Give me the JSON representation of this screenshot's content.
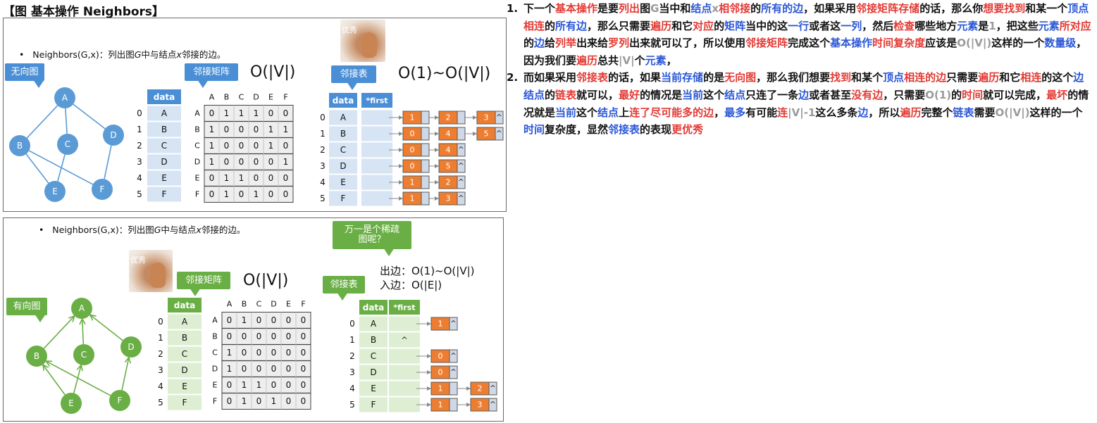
{
  "page_title": "【图 基本操作 Neighbors】",
  "colors": {
    "undirected_node": "#5b9bd5",
    "directed_node": "#6aaf45",
    "list_node": "#ed7d31",
    "table_head_blue": "#4a8fd6",
    "table_head_green": "#6aaf45",
    "highlight_red": "#e23a35",
    "highlight_blue": "#2a57d6"
  },
  "top": {
    "bullet": {
      "prefix": "Neighbors(G,x)：列出图",
      "var1": "G",
      "middle": "中与结点",
      "var2": "x",
      "suffix": "邻接的边。"
    },
    "graph_label": "无向图",
    "matrix_label": "邻接矩阵",
    "matrix_complexity": "O(|V|)",
    "list_label": "邻接表",
    "list_complexity": "O(1)~O(|V|)",
    "photo_text": "优秀"
  },
  "bottom": {
    "bullet": {
      "prefix": "Neighbors(G,x)：列出图",
      "var1": "G",
      "middle": "中与结点",
      "var2": "x",
      "suffix": "邻接的边。"
    },
    "graph_label": "有向图",
    "matrix_label": "邻接矩阵",
    "matrix_complexity": "O(|V|)",
    "list_label": "邻接表",
    "sparse_note": "万一是个稀疏图呢？",
    "out_edge": "出边：O(1)~O(|V|)",
    "in_edge": "入边：O(|E|)",
    "photo_text": "优秀"
  },
  "vertices": [
    "A",
    "B",
    "C",
    "D",
    "E",
    "F"
  ],
  "indices": [
    "0",
    "1",
    "2",
    "3",
    "4",
    "5"
  ],
  "data_header": "data",
  "first_header": "*first",
  "null_mark": "^",
  "undirected": {
    "edges": [
      [
        "A",
        "B"
      ],
      [
        "A",
        "C"
      ],
      [
        "A",
        "D"
      ],
      [
        "B",
        "E"
      ],
      [
        "B",
        "F"
      ],
      [
        "C",
        "E"
      ],
      [
        "D",
        "F"
      ]
    ],
    "matrix": [
      [
        0,
        1,
        1,
        1,
        0,
        0
      ],
      [
        1,
        0,
        0,
        0,
        1,
        1
      ],
      [
        1,
        0,
        0,
        0,
        1,
        0
      ],
      [
        1,
        0,
        0,
        0,
        0,
        1
      ],
      [
        0,
        1,
        1,
        0,
        0,
        0
      ],
      [
        0,
        1,
        0,
        1,
        0,
        0
      ]
    ],
    "adjacency": [
      [
        1,
        2,
        3
      ],
      [
        0,
        4,
        5
      ],
      [
        0,
        4
      ],
      [
        0,
        5
      ],
      [
        1,
        2
      ],
      [
        1,
        3
      ]
    ]
  },
  "directed": {
    "edges": [
      [
        "B",
        "A"
      ],
      [
        "C",
        "A"
      ],
      [
        "D",
        "A"
      ],
      [
        "E",
        "B"
      ],
      [
        "E",
        "C"
      ],
      [
        "F",
        "B"
      ],
      [
        "F",
        "D"
      ]
    ],
    "matrix": [
      [
        0,
        1,
        0,
        0,
        0,
        0
      ],
      [
        0,
        0,
        0,
        0,
        0,
        0
      ],
      [
        1,
        0,
        0,
        0,
        0,
        0
      ],
      [
        1,
        0,
        0,
        0,
        0,
        0
      ],
      [
        0,
        1,
        1,
        0,
        0,
        0
      ],
      [
        0,
        1,
        0,
        1,
        0,
        0
      ]
    ],
    "adjacency": [
      [
        1
      ],
      [],
      [
        0
      ],
      [
        0
      ],
      [
        1,
        2
      ],
      [
        1,
        3
      ]
    ]
  },
  "explanation": {
    "p1_num": "1.",
    "p1": [
      [
        "n",
        "下一个"
      ],
      [
        "r",
        "基本操作"
      ],
      [
        "n",
        "是要"
      ],
      [
        "r",
        "列出"
      ],
      [
        "n",
        "图"
      ],
      [
        "g",
        "G"
      ],
      [
        "n",
        "当中和"
      ],
      [
        "b",
        "结点"
      ],
      [
        "g",
        "x"
      ],
      [
        "r",
        "相邻接"
      ],
      [
        "n",
        "的"
      ],
      [
        "b",
        "所有的边"
      ],
      [
        "n",
        "，如果采用"
      ],
      [
        "r",
        "邻接矩阵存储"
      ],
      [
        "n",
        "的话，那么你"
      ],
      [
        "r",
        "想要找到"
      ],
      [
        "n",
        "和某一个"
      ],
      [
        "b",
        "顶点"
      ],
      [
        "r",
        "相连"
      ],
      [
        "n",
        "的"
      ],
      [
        "b",
        "所有边"
      ],
      [
        "n",
        "，那么只需要"
      ],
      [
        "r",
        "遍历"
      ],
      [
        "n",
        "和它"
      ],
      [
        "r",
        "对应"
      ],
      [
        "n",
        "的"
      ],
      [
        "b",
        "矩阵"
      ],
      [
        "n",
        "当中的这"
      ],
      [
        "b",
        "一行"
      ],
      [
        "n",
        "或者这"
      ],
      [
        "b",
        "一列"
      ],
      [
        "n",
        "，然后"
      ],
      [
        "r",
        "检查"
      ],
      [
        "n",
        "哪些地方"
      ],
      [
        "b",
        "元素"
      ],
      [
        "n",
        "是"
      ],
      [
        "g",
        "1"
      ],
      [
        "n",
        "，把这些"
      ],
      [
        "b",
        "元素"
      ],
      [
        "r",
        "所对应"
      ],
      [
        "n",
        "的"
      ],
      [
        "b",
        "边"
      ],
      [
        "n",
        "给"
      ],
      [
        "r",
        "列举"
      ],
      [
        "n",
        "出来给"
      ],
      [
        "r",
        "罗列"
      ],
      [
        "n",
        "出来就可以了，所以使用"
      ],
      [
        "r",
        "邻接矩阵"
      ],
      [
        "n",
        "完成这个"
      ],
      [
        "b",
        "基本操作"
      ],
      [
        "r",
        "时间复杂度"
      ],
      [
        "n",
        "应该"
      ],
      [
        "n",
        "是"
      ],
      [
        "g",
        "O(|V|)"
      ],
      [
        "n",
        "这样的一个"
      ],
      [
        "b",
        "数量级"
      ],
      [
        "n",
        "，因为我们要"
      ],
      [
        "r",
        "遍历"
      ],
      [
        "n",
        "总共"
      ],
      [
        "g",
        "|V|"
      ],
      [
        "n",
        "个"
      ],
      [
        "b",
        "元素"
      ],
      [
        "n",
        "，"
      ]
    ],
    "p2_num": "2.",
    "p2": [
      [
        "n",
        "而如果采用"
      ],
      [
        "r",
        "邻接表"
      ],
      [
        "n",
        "的话，如果"
      ],
      [
        "b",
        "当前存储"
      ],
      [
        "n",
        "的是"
      ],
      [
        "r",
        "无向图"
      ],
      [
        "n",
        "，那么我们想要"
      ],
      [
        "r",
        "找到"
      ],
      [
        "n",
        "和某个"
      ],
      [
        "b",
        "顶点"
      ],
      [
        "r",
        "相连的边"
      ],
      [
        "n",
        "只需要"
      ],
      [
        "r",
        "遍历"
      ],
      [
        "n",
        "和它"
      ],
      [
        "r",
        "相连"
      ],
      [
        "n",
        "的这个"
      ],
      [
        "b",
        "边结点"
      ],
      [
        "n",
        "的"
      ],
      [
        "r",
        "链表"
      ],
      [
        "n",
        "就可以，"
      ],
      [
        "r",
        "最好"
      ],
      [
        "n",
        "的情况是"
      ],
      [
        "b",
        "当前"
      ],
      [
        "n",
        "这个"
      ],
      [
        "b",
        "结点"
      ],
      [
        "n",
        "只连了一条"
      ],
      [
        "b",
        "边"
      ],
      [
        "n",
        "或者甚至"
      ],
      [
        "r",
        "没有边"
      ],
      [
        "n",
        "，只需要"
      ],
      [
        "g",
        "O(1)"
      ],
      [
        "n",
        "的"
      ],
      [
        "r",
        "时间"
      ],
      [
        "n",
        "就可以完成，"
      ],
      [
        "r",
        "最坏"
      ],
      [
        "n",
        "的情况就是"
      ],
      [
        "b",
        "当前"
      ],
      [
        "n",
        "这个"
      ],
      [
        "b",
        "结点"
      ],
      [
        "n",
        "上"
      ],
      [
        "r",
        "连了尽可能多的边"
      ],
      [
        "n",
        "，"
      ],
      [
        "b",
        "最多"
      ],
      [
        "n",
        "有可能"
      ],
      [
        "r",
        "连"
      ],
      [
        "g",
        "|V|-1"
      ],
      [
        "n",
        "这么多条"
      ],
      [
        "b",
        "边"
      ],
      [
        "n",
        "，所以"
      ],
      [
        "r",
        "遍历"
      ],
      [
        "n",
        "完"
      ],
      [
        "n",
        "整个"
      ],
      [
        "b",
        "链表"
      ],
      [
        "n",
        "需要"
      ],
      [
        "g",
        "O(|V|)"
      ],
      [
        "n",
        "这样的一个"
      ],
      [
        "b",
        "时间"
      ],
      [
        "n",
        "复杂度，显然"
      ],
      [
        "b",
        "邻接表"
      ],
      [
        "n",
        "的表现"
      ],
      [
        "r",
        "更优秀"
      ]
    ]
  }
}
